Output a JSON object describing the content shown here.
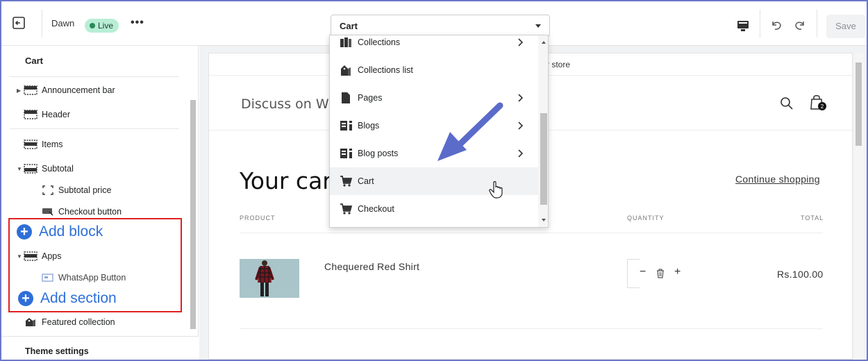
{
  "topbar": {
    "theme_name": "Dawn",
    "status_badge": "Live",
    "more_label": "•••",
    "page_selector_value": "Cart",
    "save_label": "Save"
  },
  "sidebar": {
    "title": "Cart",
    "items": [
      {
        "label": "Announcement bar",
        "icon": "section-icon"
      },
      {
        "label": "Header",
        "icon": "header-icon"
      },
      {
        "label": "Items",
        "icon": "section-icon"
      },
      {
        "label": "Subtotal",
        "icon": "section-icon"
      },
      {
        "label": "Subtotal price",
        "icon": "bracket-icon"
      },
      {
        "label": "Checkout button",
        "icon": "button-icon"
      },
      {
        "label": "Apps",
        "icon": "section-icon"
      },
      {
        "label": "WhatsApp Button",
        "icon": "app-block-icon"
      },
      {
        "label": "Featured collection",
        "icon": "collection-icon"
      }
    ],
    "add_block_label": "Add block",
    "add_section_label": "Add section",
    "theme_settings_label": "Theme settings"
  },
  "dropdown": {
    "items": [
      {
        "label": "Collections",
        "icon": "collections-icon",
        "has_submenu": true
      },
      {
        "label": "Collections list",
        "icon": "collection-icon",
        "has_submenu": false
      },
      {
        "label": "Pages",
        "icon": "page-icon",
        "has_submenu": true
      },
      {
        "label": "Blogs",
        "icon": "blog-icon",
        "has_submenu": true
      },
      {
        "label": "Blog posts",
        "icon": "blog-icon",
        "has_submenu": true
      },
      {
        "label": "Cart",
        "icon": "cart-icon",
        "has_submenu": false
      },
      {
        "label": "Checkout",
        "icon": "cart-icon",
        "has_submenu": false
      }
    ],
    "highlighted": "Cart"
  },
  "preview": {
    "announcement_text": "r store",
    "store_name": "Discuss on Wl",
    "cart_count": "2",
    "cart_title": "Your car",
    "continue_label": "Continue shopping",
    "columns": {
      "product": "PRODUCT",
      "quantity": "QUANTITY",
      "total": "TOTAL"
    },
    "line_item": {
      "name": "Chequered Red Shirt",
      "price": "Rs.100.00",
      "minus": "−",
      "plus": "+"
    }
  },
  "colors": {
    "accent_blue": "#2e6fd8",
    "highlight_red": "#e02020",
    "annotation_arrow": "#5b6bc9",
    "live_badge": "#b8eed6"
  }
}
